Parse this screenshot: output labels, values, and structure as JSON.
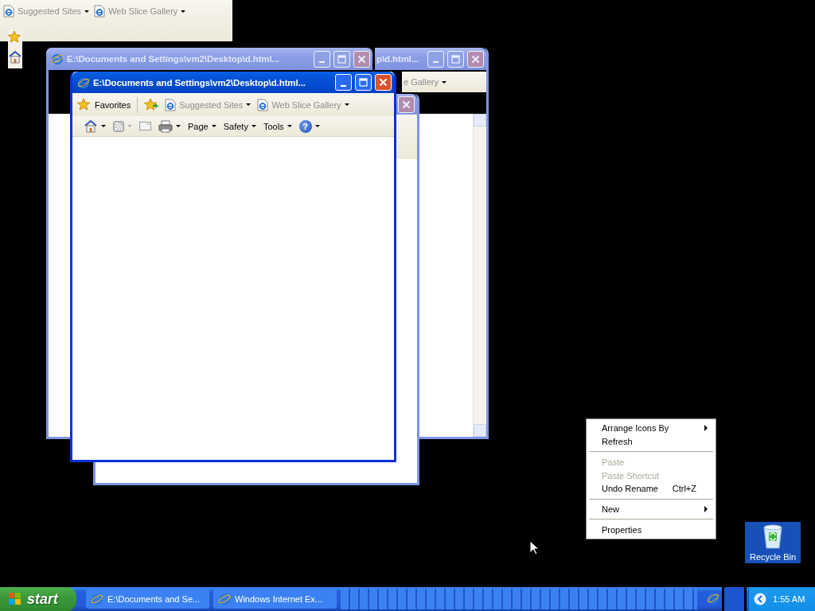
{
  "background_window": {
    "links": [
      {
        "label": "Suggested Sites"
      },
      {
        "label": "Web Slice Gallery"
      }
    ]
  },
  "back_window": {
    "title": "p\\d.html...",
    "active": false,
    "toolbar_fragment": "e Gallery"
  },
  "middle_window": {
    "title": "E:\\Documents and Settings\\vm2\\Desktop\\d.html...",
    "active": false
  },
  "rear_window": {
    "active": false
  },
  "front_window": {
    "title": "E:\\Documents and Settings\\vm2\\Desktop\\d.html...",
    "active": true,
    "favorites": "Favorites",
    "links": [
      {
        "label": "Suggested Sites"
      },
      {
        "label": "Web Slice Gallery"
      }
    ],
    "commands": [
      {
        "label": "Page"
      },
      {
        "label": "Safety"
      },
      {
        "label": "Tools"
      }
    ],
    "help": "?"
  },
  "context_menu": {
    "items": [
      {
        "kind": "item",
        "label": "Arrange Icons By",
        "disabled": false,
        "submenu": true
      },
      {
        "kind": "item",
        "label": "Refresh",
        "disabled": false,
        "submenu": false
      },
      {
        "kind": "separator"
      },
      {
        "kind": "item",
        "label": "Paste",
        "disabled": true,
        "submenu": false
      },
      {
        "kind": "item",
        "label": "Paste Shortcut",
        "disabled": true,
        "submenu": false
      },
      {
        "kind": "item",
        "label": "Undo Rename",
        "disabled": false,
        "submenu": false,
        "shortcut": "Ctrl+Z"
      },
      {
        "kind": "separator"
      },
      {
        "kind": "item",
        "label": "New",
        "disabled": false,
        "submenu": true
      },
      {
        "kind": "separator"
      },
      {
        "kind": "item",
        "label": "Properties",
        "disabled": false,
        "submenu": false
      }
    ]
  },
  "desktop_icons": [
    {
      "label": "Recycle Bin",
      "selected": true
    }
  ],
  "taskbar": {
    "start": "start",
    "buttons": [
      {
        "label": "E:\\Documents and Se...",
        "selected": false
      },
      {
        "label": "Windows Internet Ex...",
        "selected": false
      }
    ],
    "clock": "1:55 AM"
  }
}
